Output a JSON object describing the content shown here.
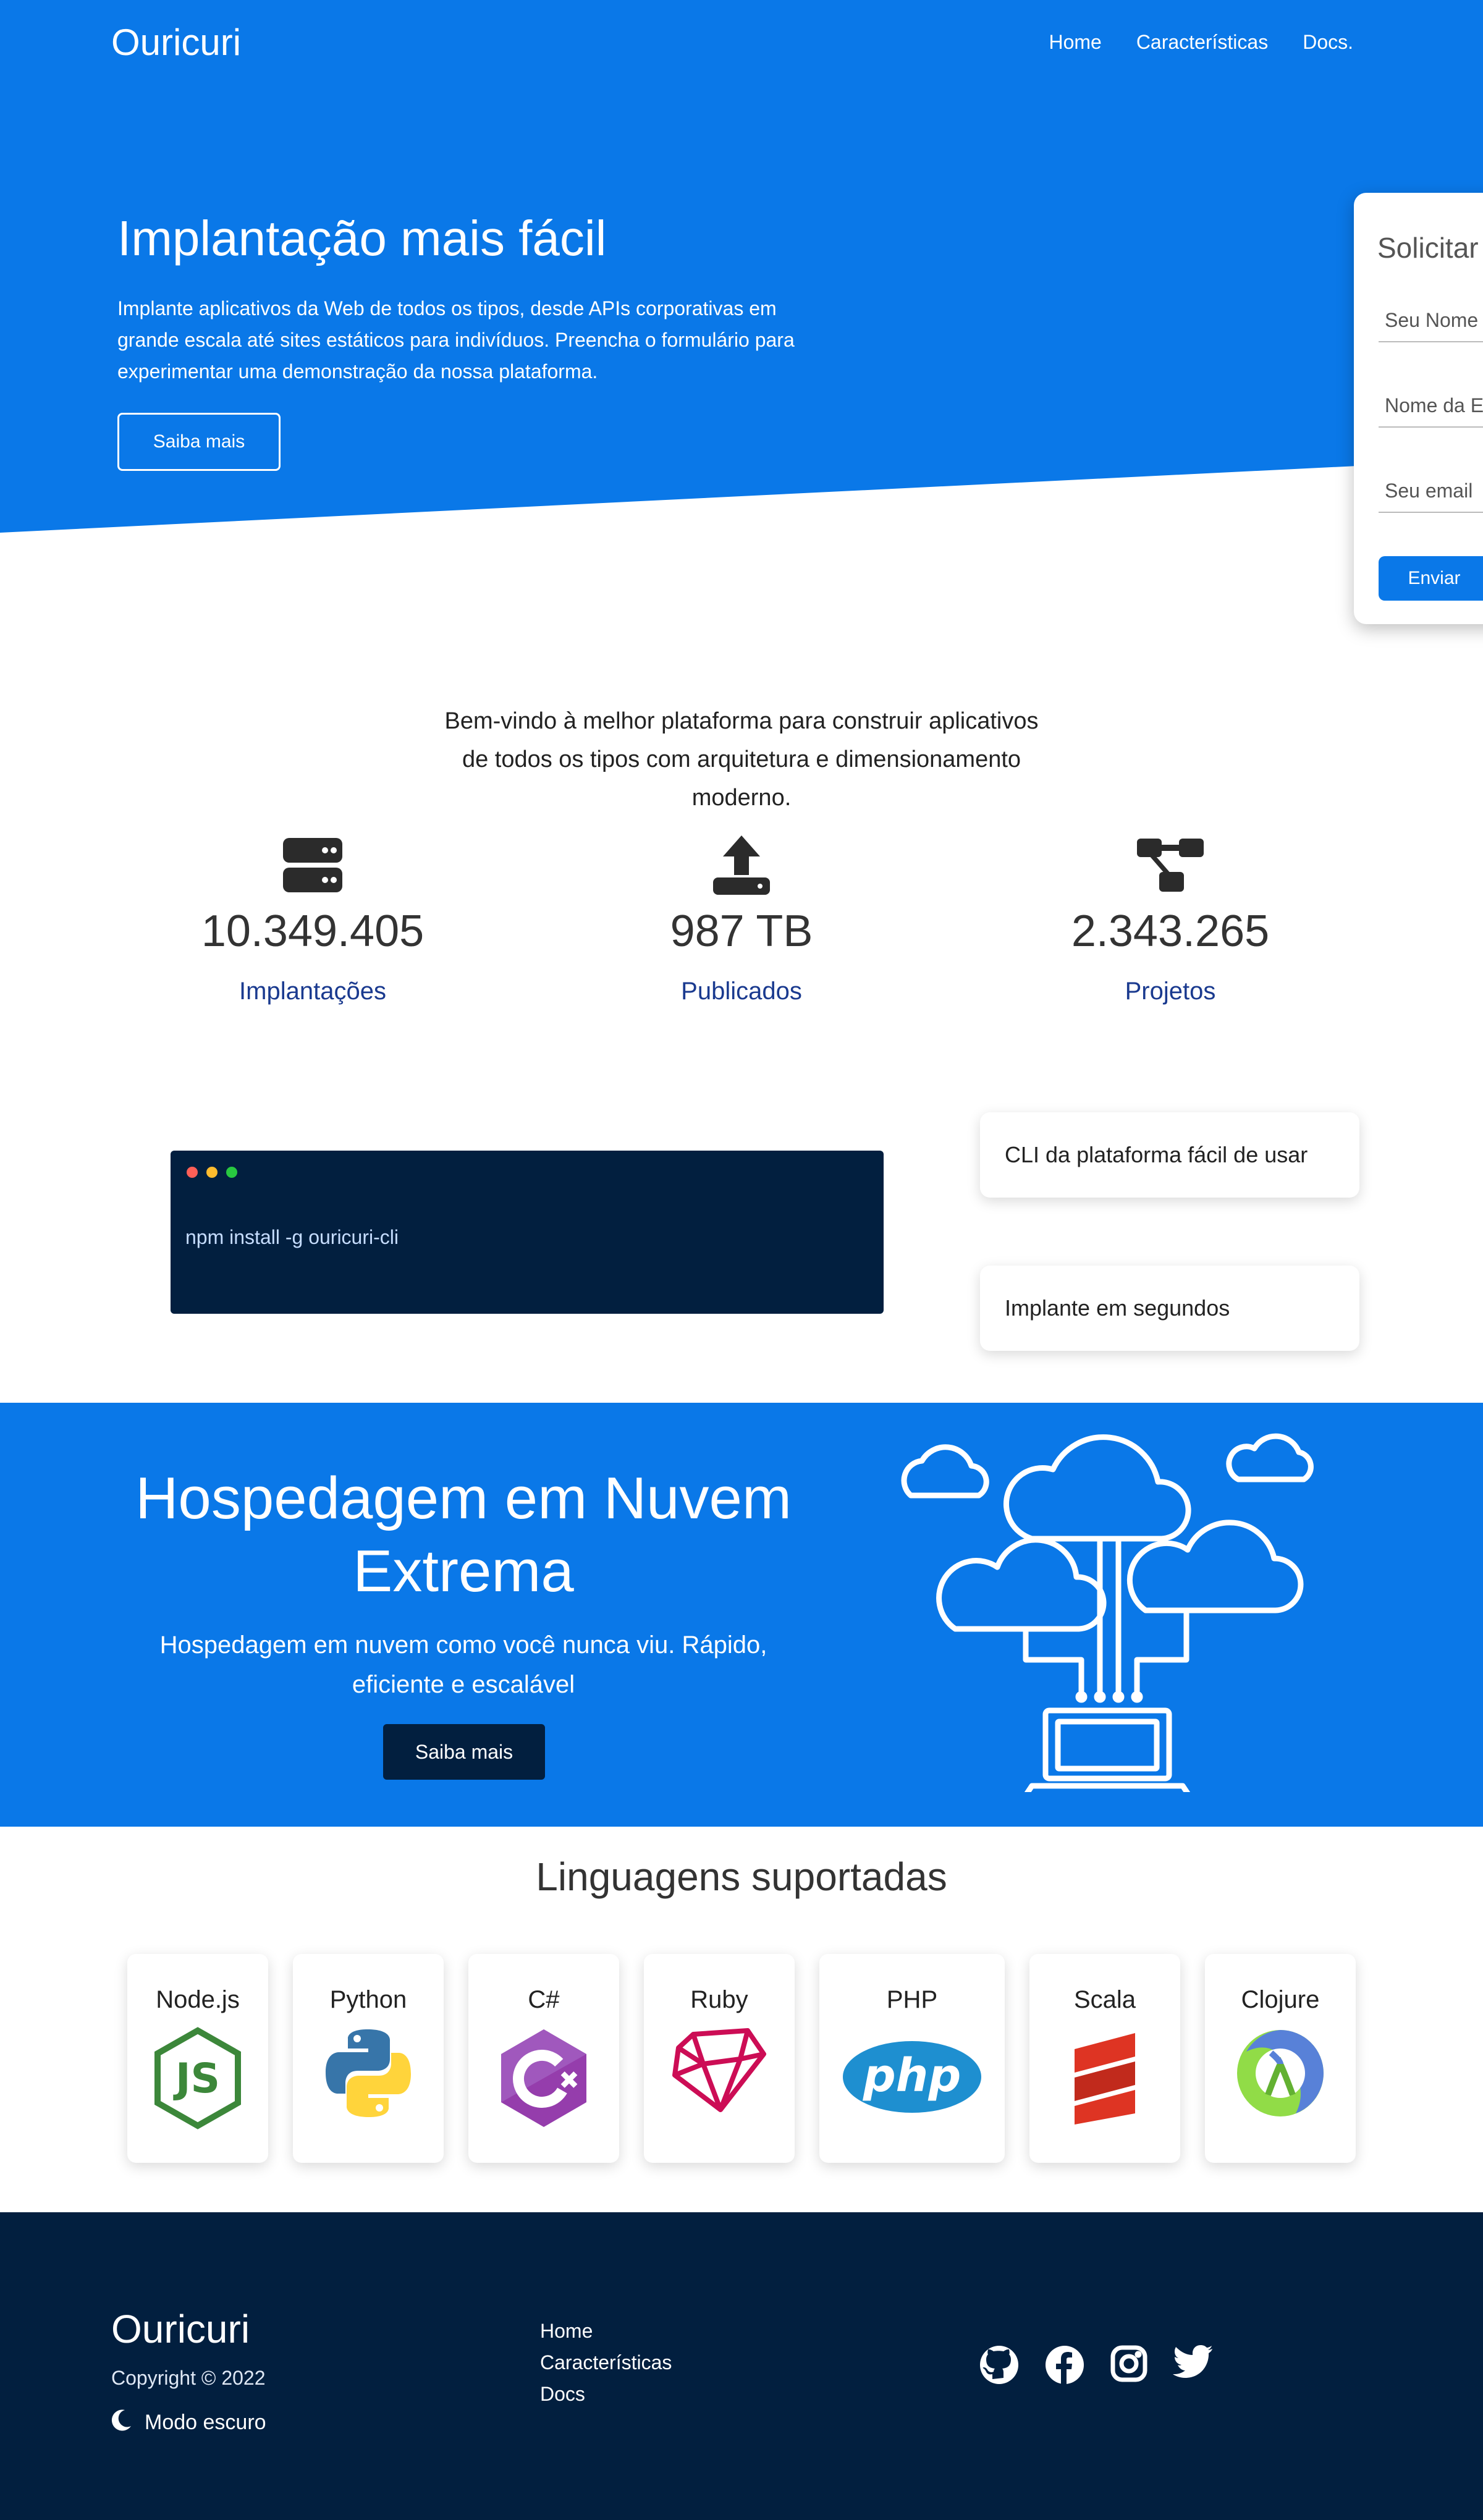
{
  "header": {
    "brand": "Ouricuri",
    "nav": [
      "Home",
      "Características",
      "Docs."
    ]
  },
  "hero": {
    "title": "Implantação mais fácil",
    "text": "Implante aplicativos da Web de todos os tipos, desde APIs corporativas em grande escala até sites estáticos para indivíduos. Preencha o formulário para experimentar uma demonstração da nossa plataforma.",
    "button": "Saiba mais"
  },
  "form": {
    "title": "Solicitar",
    "fields": [
      "Seu Nome",
      "Nome da E",
      "Seu email"
    ],
    "button": "Enviar"
  },
  "welcome": "Bem-vindo à melhor plataforma para construir aplicativos de todos os tipos com arquitetura e dimensionamento moderno.",
  "stats": [
    {
      "icon": "server-icon",
      "value": "10.349.405",
      "label": "Implantações"
    },
    {
      "icon": "upload-icon",
      "value": "987 TB",
      "label": "Publicados"
    },
    {
      "icon": "project-diagram-icon",
      "value": "2.343.265",
      "label": "Projetos"
    }
  ],
  "terminal": {
    "command": "npm install -g ouricuri-cli",
    "dot_colors": [
      "#ff5f57",
      "#febc2e",
      "#28c840"
    ]
  },
  "features": [
    "CLI da plataforma fácil de usar",
    "Implante em segundos"
  ],
  "cloud": {
    "title": "Hospedagem em Nuvem Extrema",
    "text": "Hospedagem em nuvem como você nunca viu. Rápido, eficiente e escalável",
    "button": "Saiba mais"
  },
  "languages": {
    "title": "Linguagens suportadas",
    "items": [
      "Node.js",
      "Python",
      "C#",
      "Ruby",
      "PHP",
      "Scala",
      "Clojure"
    ]
  },
  "footer": {
    "brand": "Ouricuri",
    "copyright": "Copyright © 2022",
    "dark_mode": "Modo escuro",
    "links": [
      "Home",
      "Características",
      "Docs"
    ],
    "social": [
      "github-icon",
      "facebook-icon",
      "instagram-icon",
      "twitter-icon"
    ]
  },
  "colors": {
    "primary": "#0a78e8",
    "dark": "#021f3f",
    "link": "#1a3a8f"
  }
}
